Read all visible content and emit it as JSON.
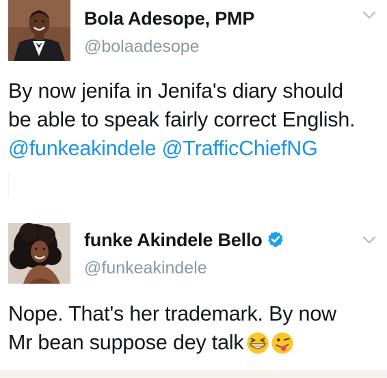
{
  "tweets": [
    {
      "name": "Bola Adesope, PMP",
      "handle": "@bolaadesope",
      "verified": false,
      "text_lines": [
        "By now jenifa in Jenifa's diary should",
        "be able to speak fairly correct English."
      ],
      "mentions": [
        "@funkeakindele",
        "@TrafficChiefNG"
      ],
      "avatar_icon": "profile-photo-man-tuxedo",
      "menu_icon": "chevron-down-icon"
    },
    {
      "name": "funke Akindele Bello",
      "handle": "@funkeakindele",
      "verified": true,
      "text_lines": [
        "Nope. That's her trademark. By now",
        "Mr bean suppose dey talk"
      ],
      "emojis": [
        "grinning-squinting-face-emoji",
        "winking-tongue-face-emoji"
      ],
      "avatar_icon": "profile-photo-woman-curly-hair",
      "menu_icon": "chevron-down-icon"
    }
  ],
  "colors": {
    "text": "#14171a",
    "handle": "#8899a6",
    "link": "#1b95e0",
    "verified": "#1da1f2",
    "chevron": "#b0bac3",
    "bottom_bar": "#f5f3ec"
  }
}
